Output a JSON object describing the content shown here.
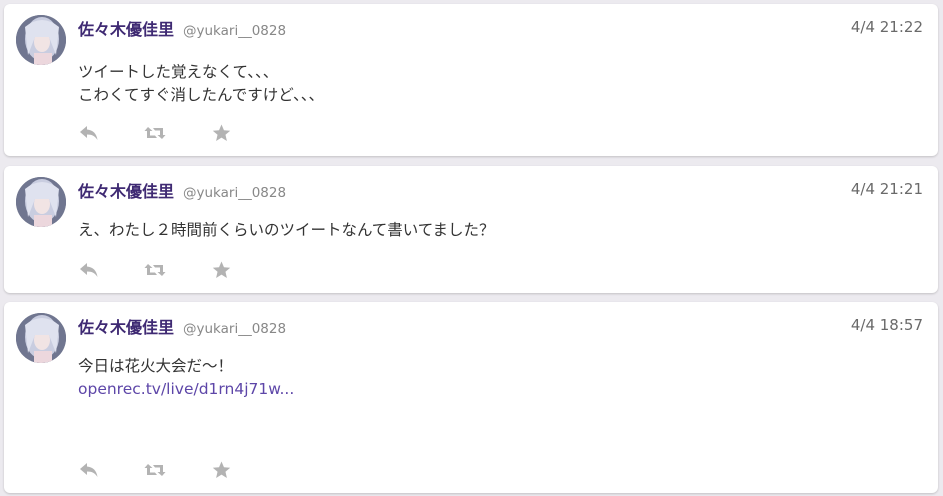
{
  "tweets": [
    {
      "display_name": "佐々木優佳里",
      "handle": "@yukari__0828",
      "timestamp": "4/4 21:22",
      "lines": [
        "ツイートした覚えなくて、、、",
        "こわくてすぐ消したんですけど、、、"
      ]
    },
    {
      "display_name": "佐々木優佳里",
      "handle": "@yukari__0828",
      "timestamp": "4/4 21:21",
      "lines": [
        "え、わたし２時間前くらいのツイートなんて書いてました？"
      ]
    },
    {
      "display_name": "佐々木優佳里",
      "handle": "@yukari__0828",
      "timestamp": "4/4 18:57",
      "lines": [
        "今日は花火大会だ〜！"
      ],
      "link": "openrec.tv/live/d1rn4j71w..."
    }
  ],
  "actions": [
    {
      "icon": "reply-icon"
    },
    {
      "icon": "retweet-icon"
    },
    {
      "icon": "favorite-star-icon"
    }
  ],
  "colors": {
    "display_name": "#3f2a73",
    "link": "#5d46a8",
    "icon": "#b3b3b3",
    "background": "#eceaef"
  }
}
